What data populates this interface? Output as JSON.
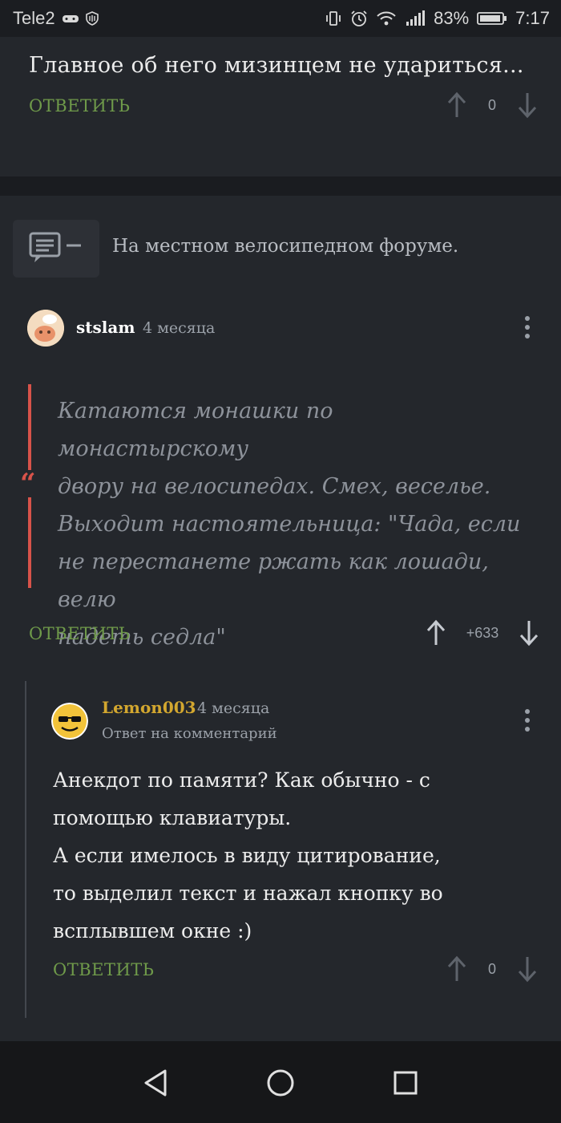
{
  "status_bar": {
    "carrier": "Tele2",
    "battery": "83%",
    "time": "7:17"
  },
  "comment_top": {
    "text": "Главное об него мизинцем не удариться...",
    "reply_label": "ОТВЕТИТЬ",
    "score": "0"
  },
  "parent_ref": {
    "text": "На местном велосипедном форуме."
  },
  "comment_main": {
    "author": "stslam",
    "time": "4 месяца",
    "quote_lines": [
      "Катаются монашки по монастырскому",
      "двору на велосипедах. Смех, веселье.",
      "Выходит настоятельница: \"Чада, если",
      "не перестанете ржать как лошади, велю",
      "надеть седла\""
    ],
    "reply_label": "ОТВЕТИТЬ",
    "score": "+633"
  },
  "comment_reply": {
    "author": "Lemon003",
    "time": "4 месяца",
    "subtitle": "Ответ на комментарий",
    "body_lines": [
      "Анекдот по памяти? Как обычно - с",
      "помощью клавиатуры.",
      "А если имелось в виду цитирование,",
      "то выделил текст и нажал кнопку во",
      "всплывшем окне :)"
    ],
    "reply_label": "ОТВЕТИТЬ",
    "score": "0"
  },
  "colors": {
    "accent_green": "#6f9a4a",
    "quote_red": "#d8534a",
    "author_gold": "#d3a72f",
    "background": "#24272c"
  },
  "icons": [
    "wifi-icon",
    "alarm-icon",
    "vibrate-icon",
    "battery-icon",
    "signal-icon",
    "comment-icon",
    "arrow-up-icon",
    "arrow-down-icon",
    "more-icon",
    "back-icon",
    "home-icon",
    "recents-icon"
  ]
}
